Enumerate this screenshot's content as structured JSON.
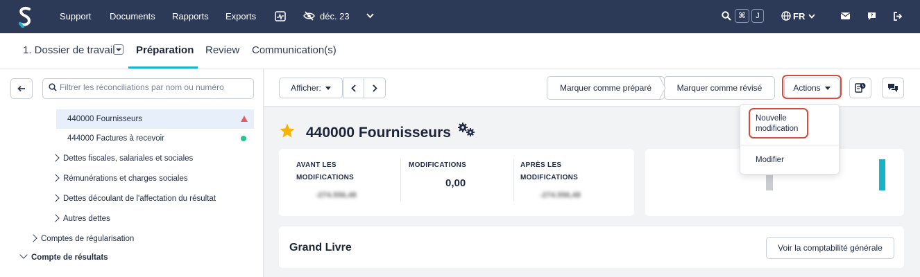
{
  "nav": {
    "links": [
      "Support",
      "Documents",
      "Rapports",
      "Exports"
    ],
    "period": "déc. 23",
    "shortcut_keys": [
      "⌘",
      "J"
    ],
    "language": "FR"
  },
  "tabs": {
    "items": [
      "1. Dossier de travail",
      "Préparation",
      "Review",
      "Communication(s)"
    ],
    "active": "Préparation"
  },
  "sidebar": {
    "search_placeholder": "Filtrer les réconciliations par nom ou numéro",
    "tree": [
      {
        "label": "440000 Fournisseurs",
        "status": "warning",
        "selected": true
      },
      {
        "label": "444000 Factures à recevoir",
        "status": "ok"
      },
      {
        "label": "Dettes fiscales, salariales et sociales",
        "expandable": true
      },
      {
        "label": "Rémunérations et charges sociales",
        "expandable": true
      },
      {
        "label": "Dettes découlant de l'affectation du résultat",
        "expandable": true
      },
      {
        "label": "Autres dettes",
        "expandable": true
      },
      {
        "label": "Comptes de régularisation",
        "expandable": true
      },
      {
        "label": "Compte de résultats",
        "expanded": true
      }
    ]
  },
  "toolbar": {
    "afficher_label": "Afficher:",
    "mark_prepared_label": "Marquer comme préparé",
    "mark_reviewed_label": "Marquer comme révisé",
    "actions_label": "Actions"
  },
  "actions_menu": {
    "items": [
      "Nouvelle modification",
      "Modifier"
    ]
  },
  "account": {
    "title": "440000 Fournisseurs"
  },
  "summary": {
    "before_label": "AVANT LES MODIFICATIONS",
    "before_value": "-274.556,48",
    "modifications_label": "MODIFICATIONS",
    "modifications_value": "0,00",
    "after_label": "APRÈS LES MODIFICATIONS",
    "after_value": "-274.556,48"
  },
  "grand_livre": {
    "title": "Grand Livre",
    "view_gl_label": "Voir la comptabilité générale"
  },
  "colors": {
    "nav_bg": "#2c3a57",
    "accent": "#17b3c8",
    "highlight": "#d84b3c",
    "warning": "#e85a63",
    "ok": "#26c48e",
    "star": "#f4b400"
  }
}
